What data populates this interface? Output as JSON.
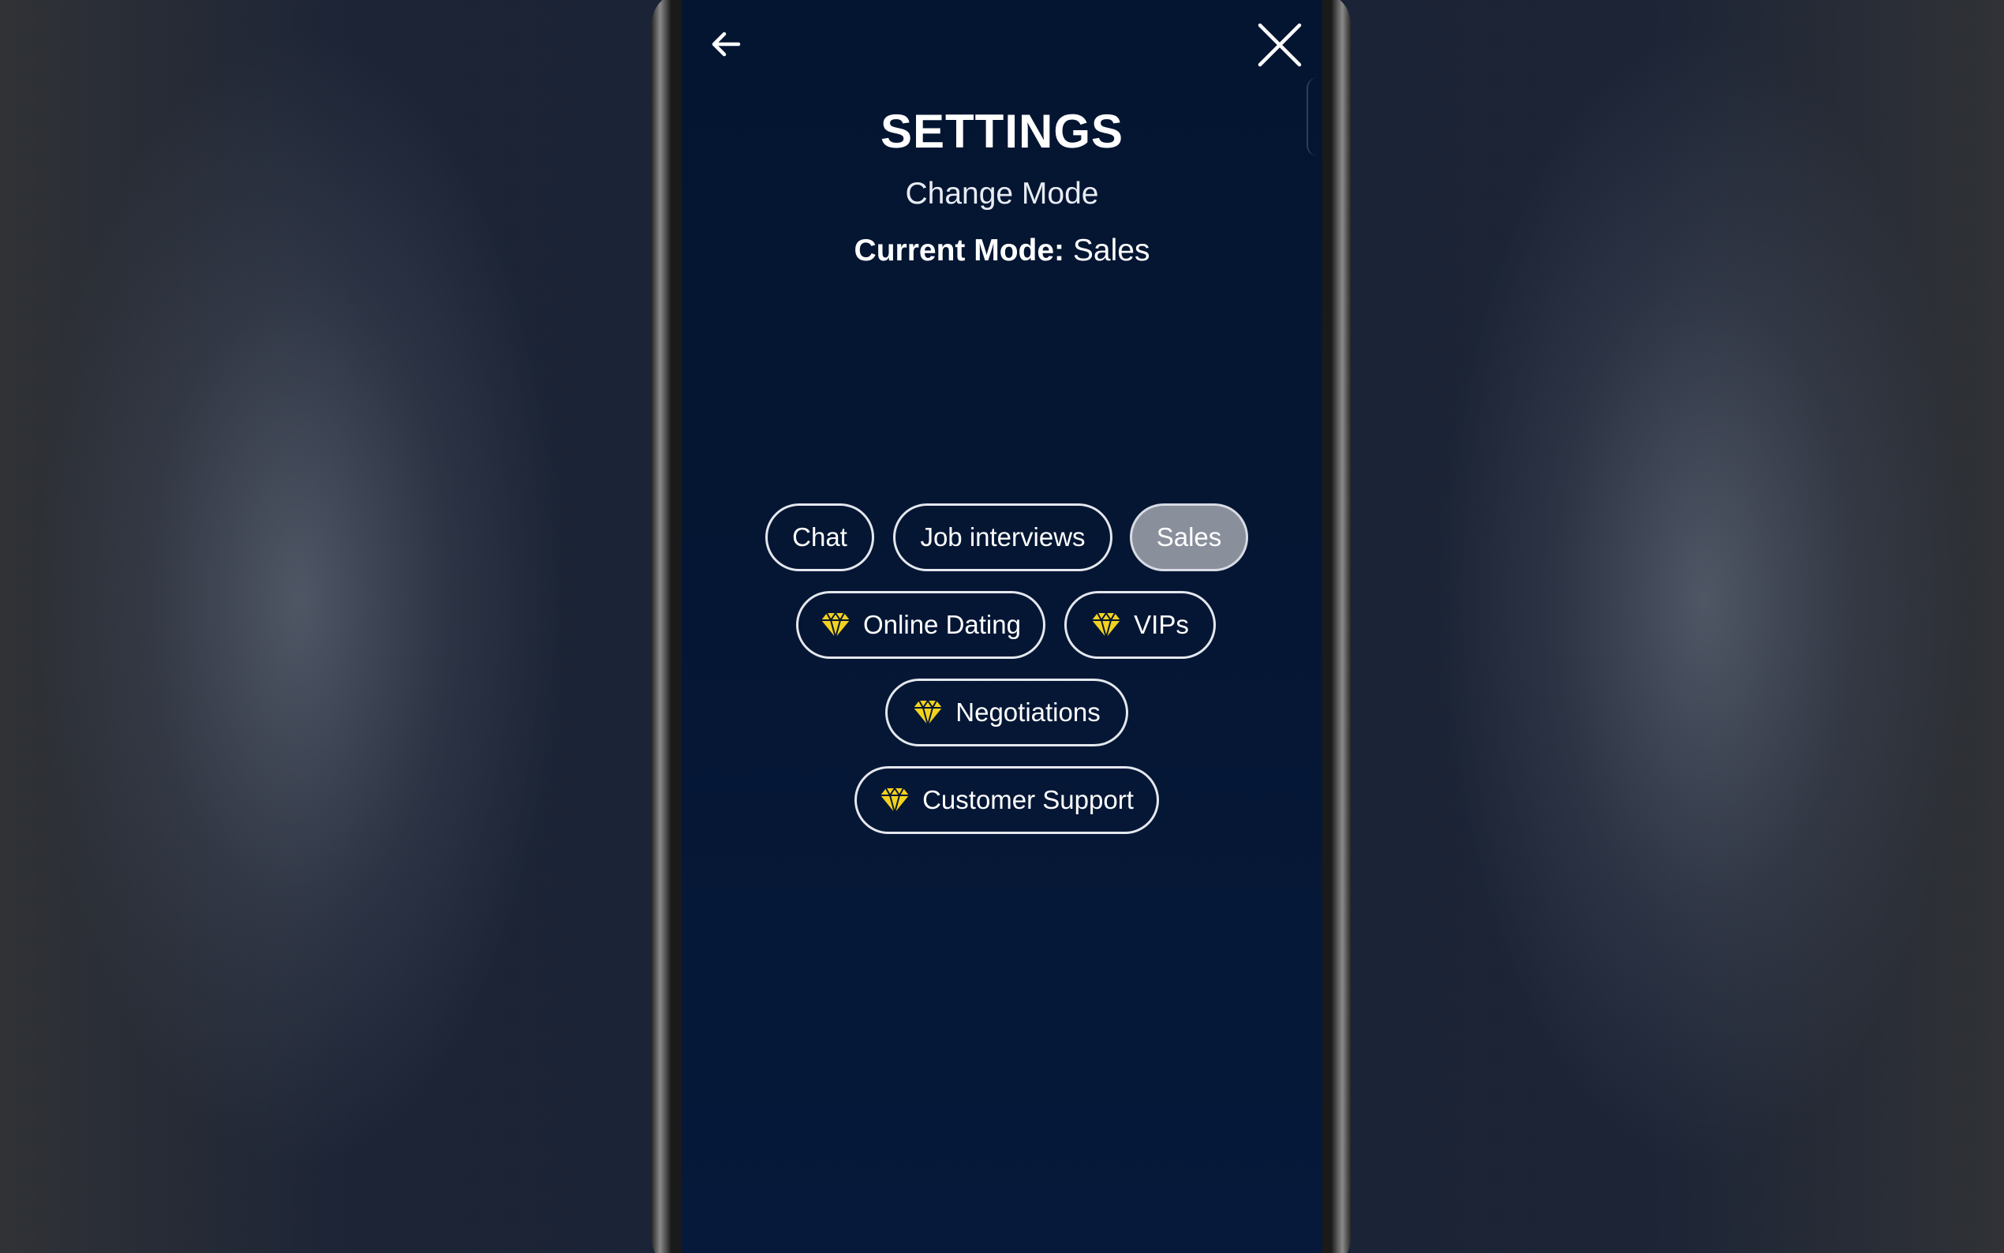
{
  "header": {
    "title": "SETTINGS",
    "subtitle": "Change Mode",
    "current_mode_label": "Current Mode:",
    "current_mode_value": "Sales"
  },
  "nav": {
    "back_icon": "arrow-left-icon",
    "close_icon": "close-icon"
  },
  "modes": [
    {
      "label": "Chat",
      "premium": false,
      "selected": false
    },
    {
      "label": "Job interviews",
      "premium": false,
      "selected": false
    },
    {
      "label": "Sales",
      "premium": false,
      "selected": true
    },
    {
      "label": "Online Dating",
      "premium": true,
      "selected": false
    },
    {
      "label": "VIPs",
      "premium": true,
      "selected": false
    },
    {
      "label": "Negotiations",
      "premium": true,
      "selected": false
    },
    {
      "label": "Customer Support",
      "premium": true,
      "selected": false
    }
  ],
  "colors": {
    "screen_background": "#041532",
    "selected_pill": "#8a8f9c",
    "premium_gem": "#f2d21f",
    "pill_border": "#e4e7ee"
  }
}
